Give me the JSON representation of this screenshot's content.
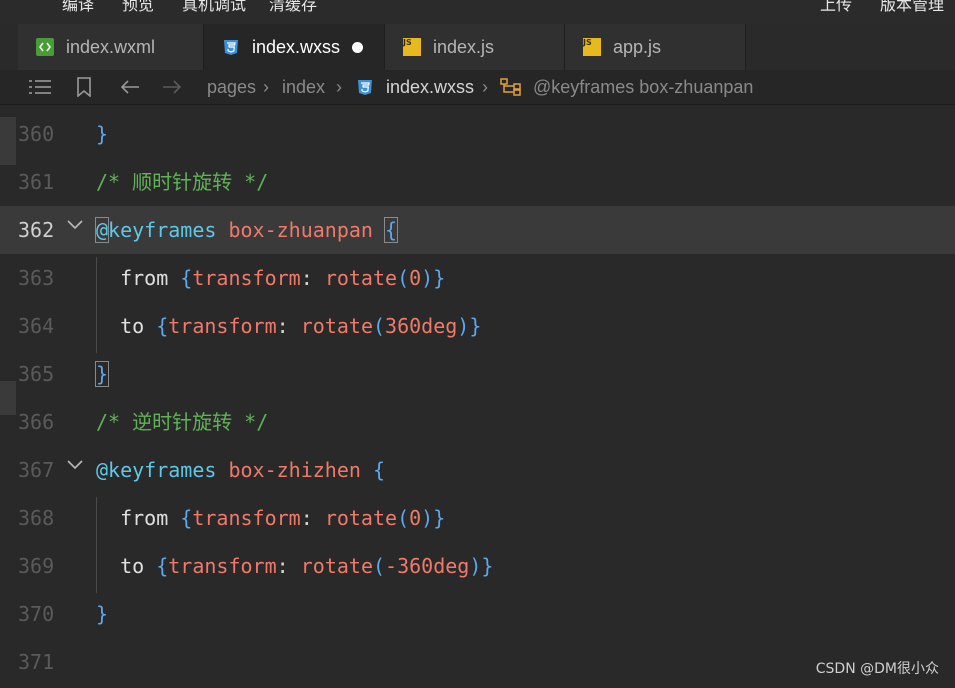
{
  "toolbar": {
    "items": [
      "编译",
      "预览",
      "真机调试",
      "清缓存"
    ],
    "right_items": [
      "上传",
      "版本管理"
    ]
  },
  "tabs": [
    {
      "label": "index.wxml",
      "icon": "wxml-file-icon",
      "active": false
    },
    {
      "label": "index.wxss",
      "icon": "css-file-icon",
      "active": true,
      "modified": true
    },
    {
      "label": "index.js",
      "icon": "js-file-icon",
      "active": false
    },
    {
      "label": "app.js",
      "icon": "js-file-icon",
      "active": false
    }
  ],
  "breadcrumb": {
    "items": [
      "pages",
      "index",
      "index.wxss",
      "@keyframes box-zhuanpan"
    ]
  },
  "editor": {
    "lines": [
      {
        "num": "360",
        "text": "}"
      },
      {
        "num": "361",
        "text": "/* 顺时针旋转 */"
      },
      {
        "num": "362",
        "text": "@keyframes box-zhuanpan {"
      },
      {
        "num": "363",
        "text": "  from {transform: rotate(0)}"
      },
      {
        "num": "364",
        "text": "  to {transform: rotate(360deg)}"
      },
      {
        "num": "365",
        "text": "}"
      },
      {
        "num": "366",
        "text": "/* 逆时针旋转 */"
      },
      {
        "num": "367",
        "text": "@keyframes box-zhizhen {"
      },
      {
        "num": "368",
        "text": "  from {transform: rotate(0)}"
      },
      {
        "num": "369",
        "text": "  to {transform: rotate(-360deg)}"
      },
      {
        "num": "370",
        "text": "}"
      },
      {
        "num": "371",
        "text": ""
      }
    ],
    "current_line": "362"
  },
  "watermark": "CSDN @DM很小众",
  "colors": {
    "comment": "#5fb257",
    "at_rule": "#5ec8e6",
    "identifier": "#f07a6a",
    "brace": "#5aa8ee"
  }
}
